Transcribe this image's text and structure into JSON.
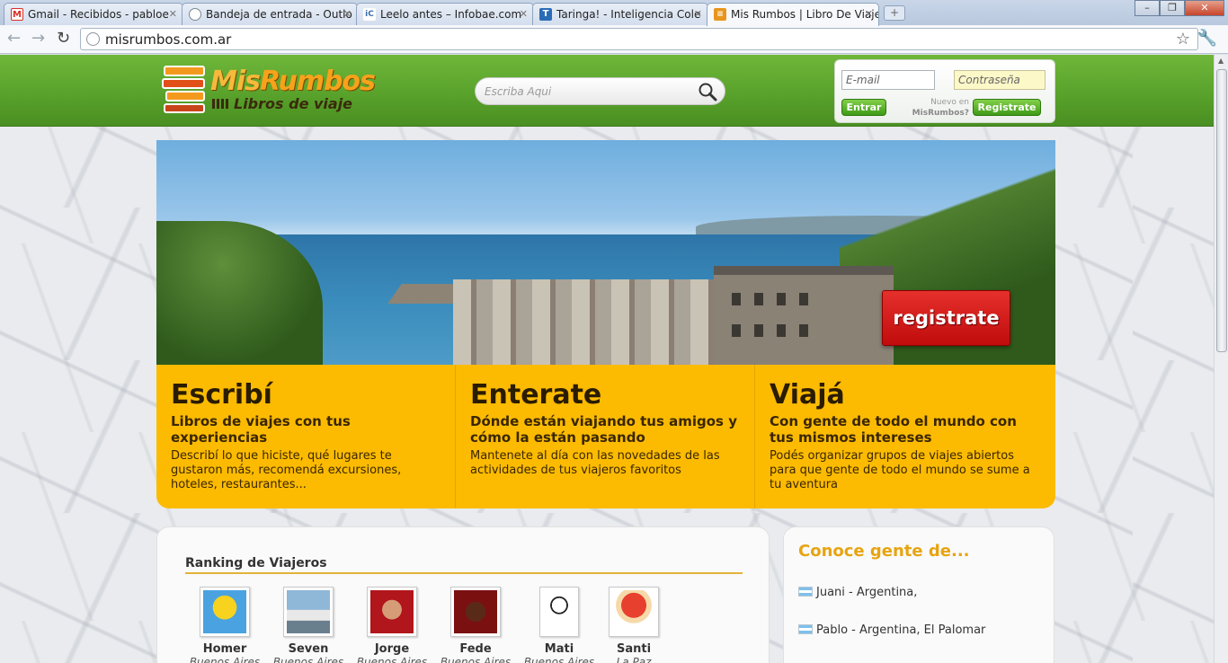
{
  "browser": {
    "tabs": [
      {
        "title": "Gmail - Recibidos - pabloe",
        "favicon": "gmail-icon",
        "color": "#d93025",
        "glyph": "M"
      },
      {
        "title": "Bandeja de entrada - Outlo",
        "favicon": "globe-icon",
        "color": "#7a8794",
        "glyph": ""
      },
      {
        "title": "Leelo antes – Infobae.com",
        "favicon": "infobae-icon",
        "color": "#3a6fb0",
        "glyph": "iC"
      },
      {
        "title": "Taringa! - Inteligencia Cole",
        "favicon": "taringa-icon",
        "color": "#2b6cb6",
        "glyph": "T"
      },
      {
        "title": "Mis Rumbos | Libro De Viaje",
        "favicon": "misrumbos-icon",
        "color": "#e9951b",
        "glyph": "≡"
      }
    ],
    "url": "misrumbos.com.ar"
  },
  "header": {
    "logo_mis": "Mis",
    "logo_rumbos": "Rumbos",
    "logo_sub": "Libros de viaje",
    "search_placeholder": "Escriba Aqui",
    "email_placeholder": "E-mail",
    "password_placeholder": "Contraseña",
    "login_button": "Entrar",
    "new_line1": "Nuevo en",
    "new_line2": "MisRumbos?",
    "register_button": "Registrate"
  },
  "hero": {
    "cta": "registrate"
  },
  "features": [
    {
      "title": "Escribí",
      "subtitle": "Libros de viajes con tus experiencias",
      "text": "Describí lo que hiciste, qué lugares te gustaron más, recomendá excursiones, hoteles, restaurantes..."
    },
    {
      "title": "Enterate",
      "subtitle": "Dónde están viajando tus amigos y cómo la están pasando",
      "text": "Mantenete al día con las novedades de las actividades de tus viajeros favoritos"
    },
    {
      "title": "Viajá",
      "subtitle": "Con gente de todo el mundo con tus mismos intereses",
      "text": "Podés organizar grupos de viajes abiertos para que gente de todo el mundo se sume a tu aventura"
    }
  ],
  "ranking": {
    "title": "Ranking de Viajeros",
    "travelers": [
      {
        "name": "Homer",
        "location": "Buenos Aires",
        "avatar_color": "#4aa3e0",
        "face": "#f7d21f"
      },
      {
        "name": "Seven",
        "location": "Buenos Aires",
        "avatar_color": "#8fb7d8",
        "face": "#e8e8e8"
      },
      {
        "name": "Jorge",
        "location": "Buenos Aires",
        "avatar_color": "#b0161b",
        "face": "#d59c77"
      },
      {
        "name": "Fede",
        "location": "Buenos Aires",
        "avatar_color": "#7a1010",
        "face": "#5a2a18"
      },
      {
        "name": "Mati",
        "location": "Buenos Aires",
        "avatar_color": "#ffffff",
        "face": "#f0f0f0"
      },
      {
        "name": "Santi",
        "location": "La Paz",
        "avatar_color": "#ffffff",
        "face": "#e8402e"
      }
    ]
  },
  "conoce": {
    "title": "Conoce gente de...",
    "people": [
      "Juani - Argentina,",
      "Pablo - Argentina, El Palomar"
    ]
  }
}
